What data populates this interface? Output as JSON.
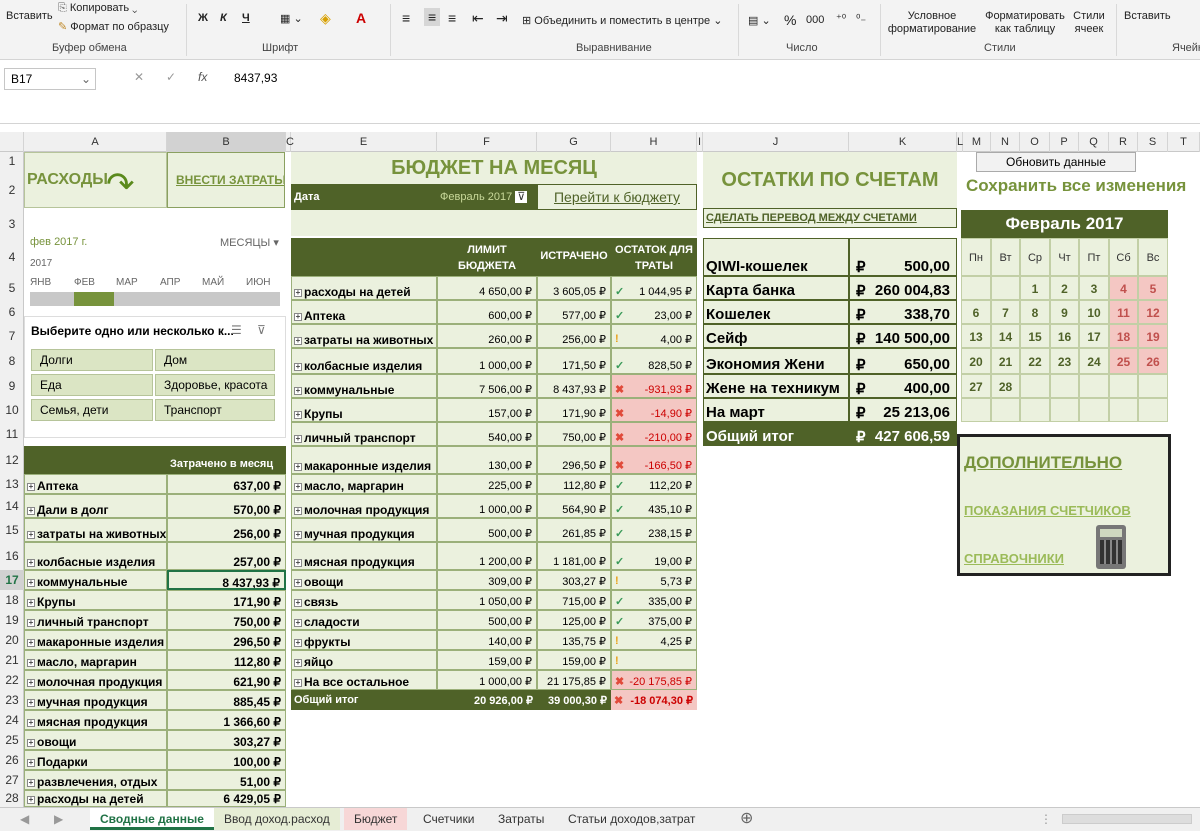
{
  "ribbon": {
    "paste": "Вставить",
    "copy": "Копировать",
    "format_painter": "Формат по образцу",
    "clipboard_group": "Буфер обмена",
    "bold": "Ж",
    "italic": "К",
    "underline": "Ч",
    "font_group": "Шрифт",
    "merge_center": "Объединить и поместить в центре",
    "align_group": "Выравнивание",
    "percent": "%",
    "comma": "000",
    "number_group": "Число",
    "cond_format": "Условное форматирование",
    "format_table": "Форматировать как таблицу",
    "cell_styles": "Стили ячеек",
    "styles_group": "Стили",
    "insert": "Вставить",
    "cells_group": "Ячейк"
  },
  "formula_bar": {
    "name_box": "B17",
    "fx": "fx",
    "value": "8437,93"
  },
  "columns": [
    "A",
    "B",
    "C",
    "E",
    "F",
    "G",
    "H",
    "I",
    "J",
    "K",
    "L",
    "M",
    "N",
    "O",
    "P",
    "Q",
    "R",
    "S",
    "T"
  ],
  "rows": [
    "1",
    "2",
    "3",
    "4",
    "5",
    "6",
    "7",
    "8",
    "9",
    "10",
    "11",
    "12",
    "13",
    "14",
    "15",
    "16",
    "17",
    "18",
    "19",
    "20",
    "21",
    "22",
    "23",
    "24",
    "25",
    "26",
    "27",
    "28"
  ],
  "left_panel": {
    "title": "РАСХОДЫ",
    "add_link": "ВНЕСТИ ЗАТРАТЫ",
    "timeline": {
      "period": "фев 2017 г.",
      "unit": "МЕСЯЦЫ",
      "year": "2017",
      "months": [
        "ЯНВ",
        "ФЕВ",
        "МАР",
        "АПР",
        "МАЙ",
        "ИЮН"
      ],
      "selected": "ФЕВ"
    },
    "slicer": {
      "title": "Выберите одно или несколько к...",
      "items": [
        "Долги",
        "Дом",
        "Еда",
        "Здоровье, красота",
        "Семья, дети",
        "Транспорт"
      ]
    },
    "table_header": "Затрачено в месяц",
    "rows": [
      {
        "name": "Аптека",
        "value": "637,00 ₽"
      },
      {
        "name": "Дали в долг",
        "value": "570,00 ₽"
      },
      {
        "name": "затраты на животных",
        "value": "256,00 ₽"
      },
      {
        "name": "колбасные изделия",
        "value": "257,00 ₽"
      },
      {
        "name": "коммунальные",
        "value": "8 437,93 ₽"
      },
      {
        "name": "Крупы",
        "value": "171,90 ₽"
      },
      {
        "name": "личный транспорт",
        "value": "750,00 ₽"
      },
      {
        "name": "макаронные изделия",
        "value": "296,50 ₽"
      },
      {
        "name": "масло, маргарин",
        "value": "112,80 ₽"
      },
      {
        "name": "молочная продукция",
        "value": "621,90 ₽"
      },
      {
        "name": "мучная продукция",
        "value": "885,45 ₽"
      },
      {
        "name": "мясная продукция",
        "value": "1 366,60 ₽"
      },
      {
        "name": "овощи",
        "value": "303,27 ₽"
      },
      {
        "name": "Подарки",
        "value": "100,00 ₽"
      },
      {
        "name": "развлечения, отдых",
        "value": "51,00 ₽"
      },
      {
        "name": "расходы на детей",
        "value": "6 429,05 ₽"
      }
    ]
  },
  "budget": {
    "title": "БЮДЖЕТ НА МЕСЯЦ",
    "date_label": "Дата",
    "date_value": "Февраль 2017",
    "goto": "Перейти к бюджету",
    "headers": [
      "ЛИМИТ БЮДЖЕТА",
      "ИСТРАЧЕНО",
      "ОСТАТОК ДЛЯ ТРАТЫ"
    ],
    "rows": [
      {
        "name": "расходы на детей",
        "limit": "4 650,00 ₽",
        "spent": "3 605,05 ₽",
        "status": "ok",
        "rest": "1 044,95 ₽"
      },
      {
        "name": "Аптека",
        "limit": "600,00 ₽",
        "spent": "577,00 ₽",
        "status": "ok",
        "rest": "23,00 ₽"
      },
      {
        "name": "затраты на животных",
        "limit": "260,00 ₽",
        "spent": "256,00 ₽",
        "status": "warn",
        "rest": "4,00 ₽"
      },
      {
        "name": "колбасные изделия",
        "limit": "1 000,00 ₽",
        "spent": "171,50 ₽",
        "status": "ok",
        "rest": "828,50 ₽"
      },
      {
        "name": "коммунальные",
        "limit": "7 506,00 ₽",
        "spent": "8 437,93 ₽",
        "status": "bad",
        "rest": "-931,93 ₽"
      },
      {
        "name": "Крупы",
        "limit": "157,00 ₽",
        "spent": "171,90 ₽",
        "status": "bad",
        "rest": "-14,90 ₽"
      },
      {
        "name": "личный транспорт",
        "limit": "540,00 ₽",
        "spent": "750,00 ₽",
        "status": "bad",
        "rest": "-210,00 ₽"
      },
      {
        "name": "макаронные изделия",
        "limit": "130,00 ₽",
        "spent": "296,50 ₽",
        "status": "bad",
        "rest": "-166,50 ₽"
      },
      {
        "name": "масло, маргарин",
        "limit": "225,00 ₽",
        "spent": "112,80 ₽",
        "status": "ok",
        "rest": "112,20 ₽"
      },
      {
        "name": "молочная продукция",
        "limit": "1 000,00 ₽",
        "spent": "564,90 ₽",
        "status": "ok",
        "rest": "435,10 ₽"
      },
      {
        "name": "мучная продукция",
        "limit": "500,00 ₽",
        "spent": "261,85 ₽",
        "status": "ok",
        "rest": "238,15 ₽"
      },
      {
        "name": "мясная продукция",
        "limit": "1 200,00 ₽",
        "spent": "1 181,00 ₽",
        "status": "ok",
        "rest": "19,00 ₽"
      },
      {
        "name": "овощи",
        "limit": "309,00 ₽",
        "spent": "303,27 ₽",
        "status": "warn",
        "rest": "5,73 ₽"
      },
      {
        "name": "связь",
        "limit": "1 050,00 ₽",
        "spent": "715,00 ₽",
        "status": "ok",
        "rest": "335,00 ₽"
      },
      {
        "name": "сладости",
        "limit": "500,00 ₽",
        "spent": "125,00 ₽",
        "status": "ok",
        "rest": "375,00 ₽"
      },
      {
        "name": "фрукты",
        "limit": "140,00 ₽",
        "spent": "135,75 ₽",
        "status": "warn",
        "rest": "4,25 ₽"
      },
      {
        "name": "яйцо",
        "limit": "159,00 ₽",
        "spent": "159,00 ₽",
        "status": "warn",
        "rest": ""
      },
      {
        "name": "На все остальное",
        "limit": "1 000,00 ₽",
        "spent": "21 175,85 ₽",
        "status": "bad",
        "rest": "-20 175,85 ₽"
      }
    ],
    "total": {
      "name": "Общий итог",
      "limit": "20 926,00 ₽",
      "spent": "39 000,30 ₽",
      "rest": "-18 074,30 ₽"
    }
  },
  "accounts": {
    "title": "ОСТАТКИ ПО СЧЕТАМ",
    "transfer": "СДЕЛАТЬ ПЕРЕВОД МЕЖДУ СЧЕТАМИ",
    "currency": "₽",
    "rows": [
      {
        "name": "QIWI-кошелек",
        "value": "500,00"
      },
      {
        "name": "Карта банка",
        "value": "260 004,83"
      },
      {
        "name": "Кошелек",
        "value": "338,70"
      },
      {
        "name": "Сейф",
        "value": "140 500,00"
      },
      {
        "name": "Экономия Жени",
        "value": "650,00"
      },
      {
        "name": "Жене на техникум",
        "value": "400,00"
      },
      {
        "name": "На март",
        "value": "25 213,06"
      }
    ],
    "total": {
      "name": "Общий итог",
      "value": "427 606,59"
    }
  },
  "right": {
    "refresh": "Обновить данные",
    "save_all": "Сохранить все изменения",
    "calendar": {
      "title": "Февраль 2017",
      "days": [
        "Пн",
        "Вт",
        "Ср",
        "Чт",
        "Пт",
        "Сб",
        "Вс"
      ],
      "weeks": [
        [
          "",
          "",
          "1",
          "2",
          "3",
          "4",
          "5"
        ],
        [
          "6",
          "7",
          "8",
          "9",
          "10",
          "11",
          "12"
        ],
        [
          "13",
          "14",
          "15",
          "16",
          "17",
          "18",
          "19"
        ],
        [
          "20",
          "21",
          "22",
          "23",
          "24",
          "25",
          "26"
        ],
        [
          "27",
          "28",
          "",
          "",
          "",
          "",
          ""
        ],
        [
          "",
          "",
          "",
          "",
          "",
          "",
          ""
        ]
      ]
    },
    "extra": {
      "title": "ДОПОЛНИТЕЛЬНО",
      "meters": "ПОКАЗАНИЯ СЧЕТЧИКОВ",
      "refs": "СПРАВОЧНИКИ"
    }
  },
  "tabs": [
    "Сводные данные",
    "Ввод доход.расход",
    "Бюджет",
    "Счетчики",
    "Затраты",
    "Статьи доходов,затрат"
  ],
  "active_tab": "Сводные данные"
}
